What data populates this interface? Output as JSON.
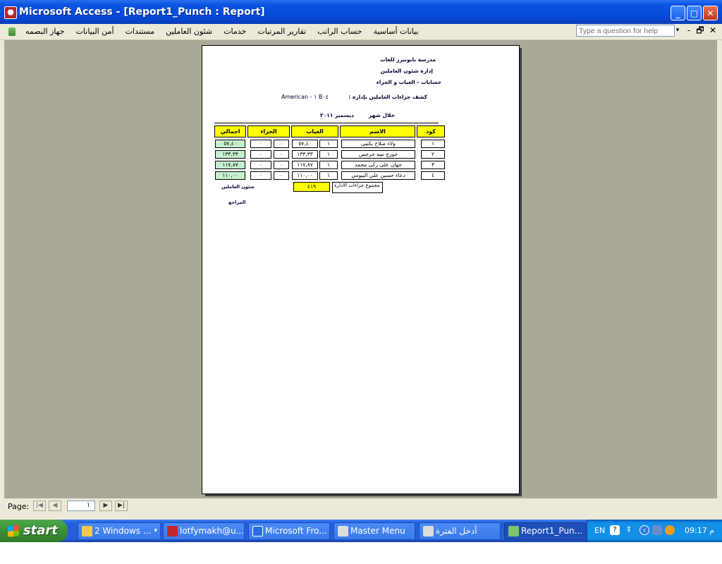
{
  "window": {
    "title": "Microsoft Access - [Report1_Punch : Report]",
    "minimize": "_",
    "maximize": "□",
    "close": "✕"
  },
  "menubar": {
    "items": [
      {
        "label": "جهاز البصمه"
      },
      {
        "label": "أمن البيانات"
      },
      {
        "label": "مستندات"
      },
      {
        "label": "شئون العاملين"
      },
      {
        "label": "خدمات"
      },
      {
        "label": "تقارير المرتبات"
      },
      {
        "label": "حساب الراتب"
      },
      {
        "label": "بيانات أساسية"
      }
    ],
    "help_placeholder": "Type a question for help",
    "help_dropdown": "▾",
    "mdi_minimize": "-",
    "mdi_restore": "🗗",
    "mdi_close": "✕"
  },
  "report": {
    "school_name": "مدرسة بابونيرز للغات",
    "department": "إدارة شئون العاملين",
    "section": "حسابات - الغياب و الجزاء",
    "report_title": "كشف جزاءات العاملين بإدارة :",
    "branch": "American - ١  B٠٤",
    "period_label": "خلال شهر",
    "period_value": "ديسمبر ٢٠١١",
    "headers": {
      "code": "كود",
      "name": "الاسم",
      "absence": "الغياب",
      "penalty": "الجزاء",
      "total": "اجمالي"
    },
    "rows": [
      {
        "code": "١",
        "name": "ولاء صلاح بكتبى",
        "absence_days": "١",
        "absence_value": "٥٧,٤٠",
        "penalty_days": "٠",
        "penalty_value": "٠",
        "total": "٥٧,٤٠"
      },
      {
        "code": "٢",
        "name": "جورج نبيه جرجس",
        "absence_days": "١",
        "absence_value": "١٣٣,٣٣",
        "penalty_days": "٠",
        "penalty_value": "٠",
        "total": "١٣٣,٣٣"
      },
      {
        "code": "٣",
        "name": "جهان على زكى محمد",
        "absence_days": "١",
        "absence_value": "١١٧,٨٧",
        "penalty_days": "٠",
        "penalty_value": "٠",
        "total": "١١٧,٨٧"
      },
      {
        "code": "٤",
        "name": "دعاء حسين على البيومي",
        "absence_days": "١",
        "absence_value": "١١٠,٠٠",
        "penalty_days": "٠",
        "penalty_value": "٠",
        "total": "١١٠,٠٠"
      }
    ],
    "sum_label": "مجموع جزاءات الادارة",
    "sum_value": "٤١٩",
    "signature_1": "شئون العاملين",
    "signature_2": "المراجع"
  },
  "nav": {
    "page_label": "Page:",
    "page_value": "١",
    "first": "|◀",
    "prev": "◀",
    "next": "▶",
    "last": "▶|"
  },
  "taskbar": {
    "start_label": "start",
    "tasks": [
      {
        "label": "2 Windows ...",
        "icon": "folder-icon",
        "color": "#f3c94a"
      },
      {
        "label": "lotfymakh@u...",
        "icon": "filezilla-icon",
        "color": "#c0272d"
      },
      {
        "label": "Microsoft Fro...",
        "icon": "frontpage-icon",
        "color": "#2b6fd6"
      },
      {
        "label": "Master Menu",
        "icon": "form-icon",
        "color": "#dcdcdc"
      },
      {
        "label": "أدخل الفترة",
        "icon": "form-icon",
        "color": "#dcdcdc"
      },
      {
        "label": "Report1_Pun...",
        "icon": "report-icon",
        "color": "#7cc46d"
      }
    ],
    "tray_lang": "EN",
    "clock": "09:17 م"
  }
}
